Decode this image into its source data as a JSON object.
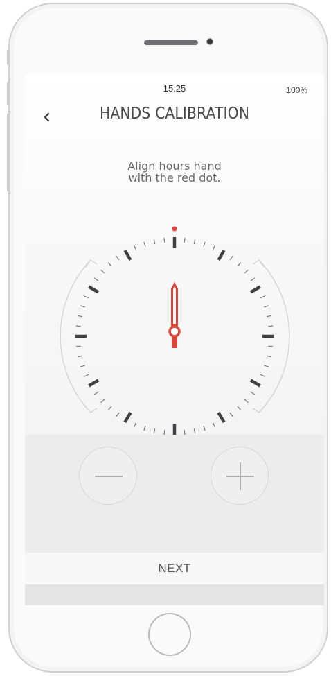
{
  "status": {
    "time": "15:25",
    "battery": "100%"
  },
  "header": {
    "title": "HANDS CALIBRATION",
    "back_icon": "chevron-left-icon"
  },
  "instruction": {
    "line1": "Align hours hand",
    "line2": "with the red dot."
  },
  "dial": {
    "hand_color": "#d9463b",
    "target_dot_color": "#d9463b",
    "hand_position_hours": 12
  },
  "controls": {
    "minus_icon": "minus-icon",
    "plus_icon": "plus-icon"
  },
  "footer": {
    "next_label": "NEXT"
  }
}
